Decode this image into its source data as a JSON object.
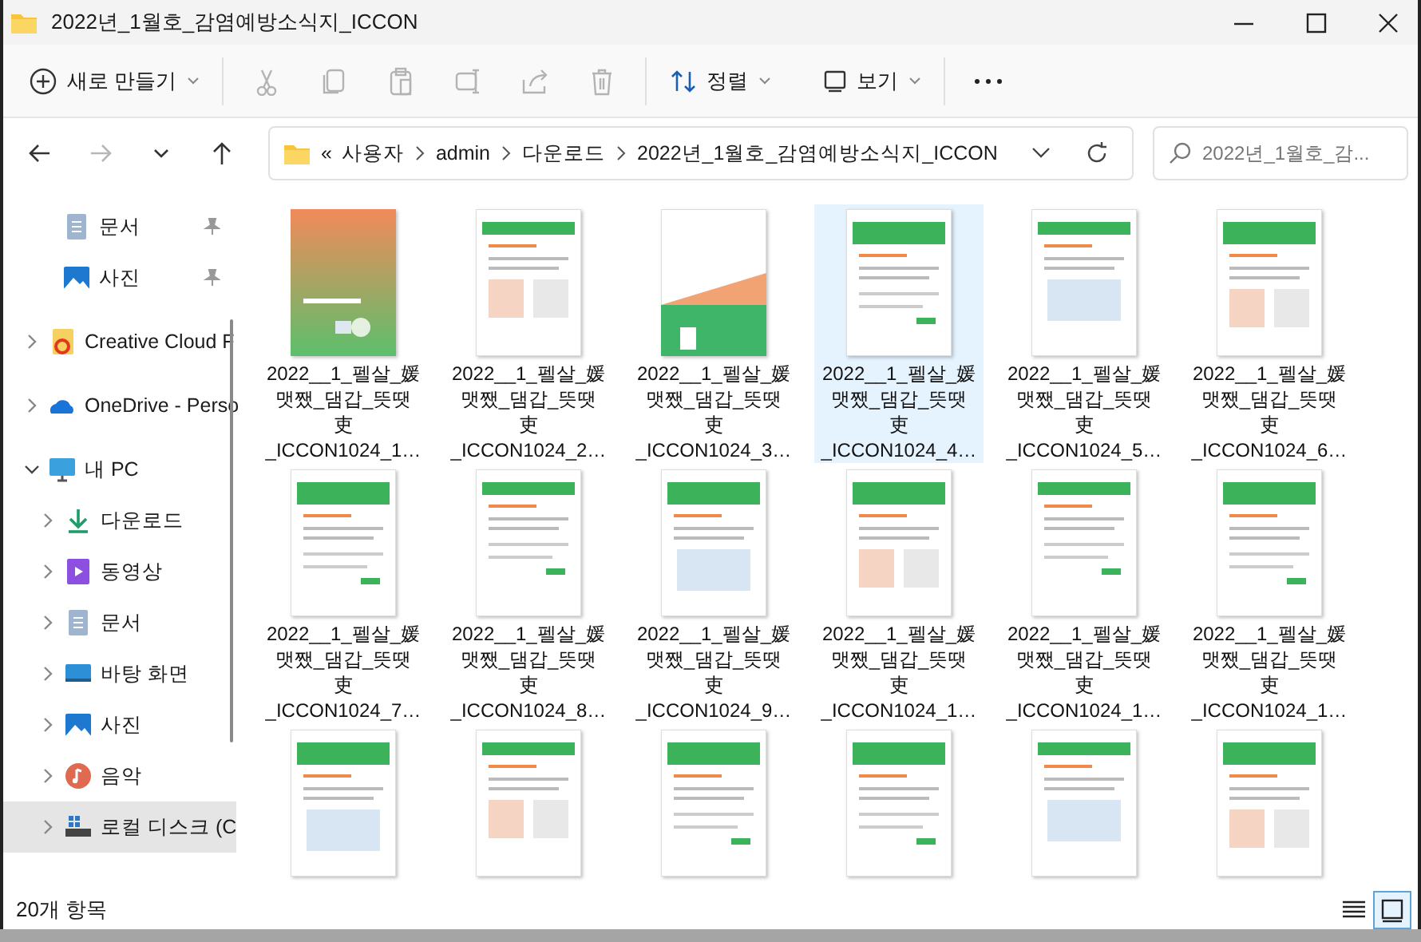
{
  "window": {
    "title": "2022년_1월호_감염예방소식지_ICCON"
  },
  "toolbar": {
    "new_label": "새로 만들기",
    "actions": [
      {
        "kind": "cut",
        "disabled": true
      },
      {
        "kind": "copy",
        "disabled": true
      },
      {
        "kind": "paste",
        "disabled": true
      },
      {
        "kind": "rename",
        "disabled": true
      },
      {
        "kind": "share",
        "disabled": true
      },
      {
        "kind": "delete",
        "disabled": true
      }
    ],
    "sort_label": "정렬",
    "view_label": "보기"
  },
  "navigation": [
    {
      "kind": "back",
      "disabled": false
    },
    {
      "kind": "forward",
      "disabled": true
    },
    {
      "kind": "recent",
      "disabled": false
    },
    {
      "kind": "up",
      "disabled": false
    }
  ],
  "address": {
    "prefix": "«",
    "breadcrumbs": [
      "사용자",
      "admin",
      "다운로드",
      "2022년_1월호_감염예방소식지_ICCON"
    ]
  },
  "search": {
    "placeholder": "2022년_1월호_감..."
  },
  "sidebar": {
    "items": [
      {
        "kind": "documents",
        "label": "문서",
        "pinned": true,
        "selected": false
      },
      {
        "kind": "pictures",
        "label": "사진",
        "pinned": true,
        "selected": false
      },
      {
        "kind": "creative-cloud",
        "label": "Creative Cloud F",
        "expanded": false,
        "selected": false
      },
      {
        "kind": "onedrive",
        "label": "OneDrive - Perso",
        "expanded": false,
        "selected": false
      },
      {
        "kind": "pc",
        "label": "내 PC",
        "expanded": true,
        "selected": false,
        "children": [
          {
            "kind": "downloads",
            "label": "다운로드",
            "expanded": false,
            "selected": false
          },
          {
            "kind": "videos",
            "label": "동영상",
            "expanded": false,
            "selected": false
          },
          {
            "kind": "documents",
            "label": "문서",
            "expanded": false,
            "selected": false
          },
          {
            "kind": "desktop",
            "label": "바탕 화면",
            "expanded": false,
            "selected": false
          },
          {
            "kind": "pictures",
            "label": "사진",
            "expanded": false,
            "selected": false
          },
          {
            "kind": "music",
            "label": "음악",
            "expanded": false,
            "selected": false
          },
          {
            "kind": "drive",
            "label": "로컬 디스크 (C",
            "expanded": false,
            "selected": true
          }
        ]
      }
    ]
  },
  "files": [
    {
      "name": "2022__1_펠살_媛\n맷쨌_댐갑_뜻땟\n吏\n_ICCON1024_1…",
      "selected": false
    },
    {
      "name": "2022__1_펠살_媛\n맷쨌_댐갑_뜻땟\n吏\n_ICCON1024_2…",
      "selected": false
    },
    {
      "name": "2022__1_펠살_媛\n맷쨌_댐갑_뜻땟\n吏\n_ICCON1024_3…",
      "selected": false
    },
    {
      "name": "2022__1_펠살_媛\n맷쨌_댐갑_뜻땟\n吏\n_ICCON1024_4…",
      "selected": true
    },
    {
      "name": "2022__1_펠살_媛\n맷쨌_댐갑_뜻땟\n吏\n_ICCON1024_5…",
      "selected": false
    },
    {
      "name": "2022__1_펠살_媛\n맷쨌_댐갑_뜻땟\n吏\n_ICCON1024_6…",
      "selected": false
    },
    {
      "name": "2022__1_펠살_媛\n맷쨌_댐갑_뜻땟\n吏\n_ICCON1024_7…",
      "selected": false
    },
    {
      "name": "2022__1_펠살_媛\n맷쨌_댐갑_뜻땟\n吏\n_ICCON1024_8…",
      "selected": false
    },
    {
      "name": "2022__1_펠살_媛\n맷쨌_댐갑_뜻땟\n吏\n_ICCON1024_9…",
      "selected": false
    },
    {
      "name": "2022__1_펠살_媛\n맷쨌_댐갑_뜻땟\n吏\n_ICCON1024_1…",
      "selected": false
    },
    {
      "name": "2022__1_펠살_媛\n맷쨌_댐갑_뜻땟\n吏\n_ICCON1024_1…",
      "selected": false
    },
    {
      "name": "2022__1_펠살_媛\n맷쨌_댐갑_뜻땟\n吏\n_ICCON1024_1…",
      "selected": false
    },
    {
      "selected": false
    },
    {
      "selected": false
    },
    {
      "selected": false
    },
    {
      "selected": false
    },
    {
      "selected": false
    },
    {
      "selected": false
    }
  ],
  "status_bar": {
    "count": "20개 항목",
    "views": [
      {
        "kind": "details",
        "selected": false
      },
      {
        "kind": "large-icons",
        "selected": true
      }
    ]
  }
}
